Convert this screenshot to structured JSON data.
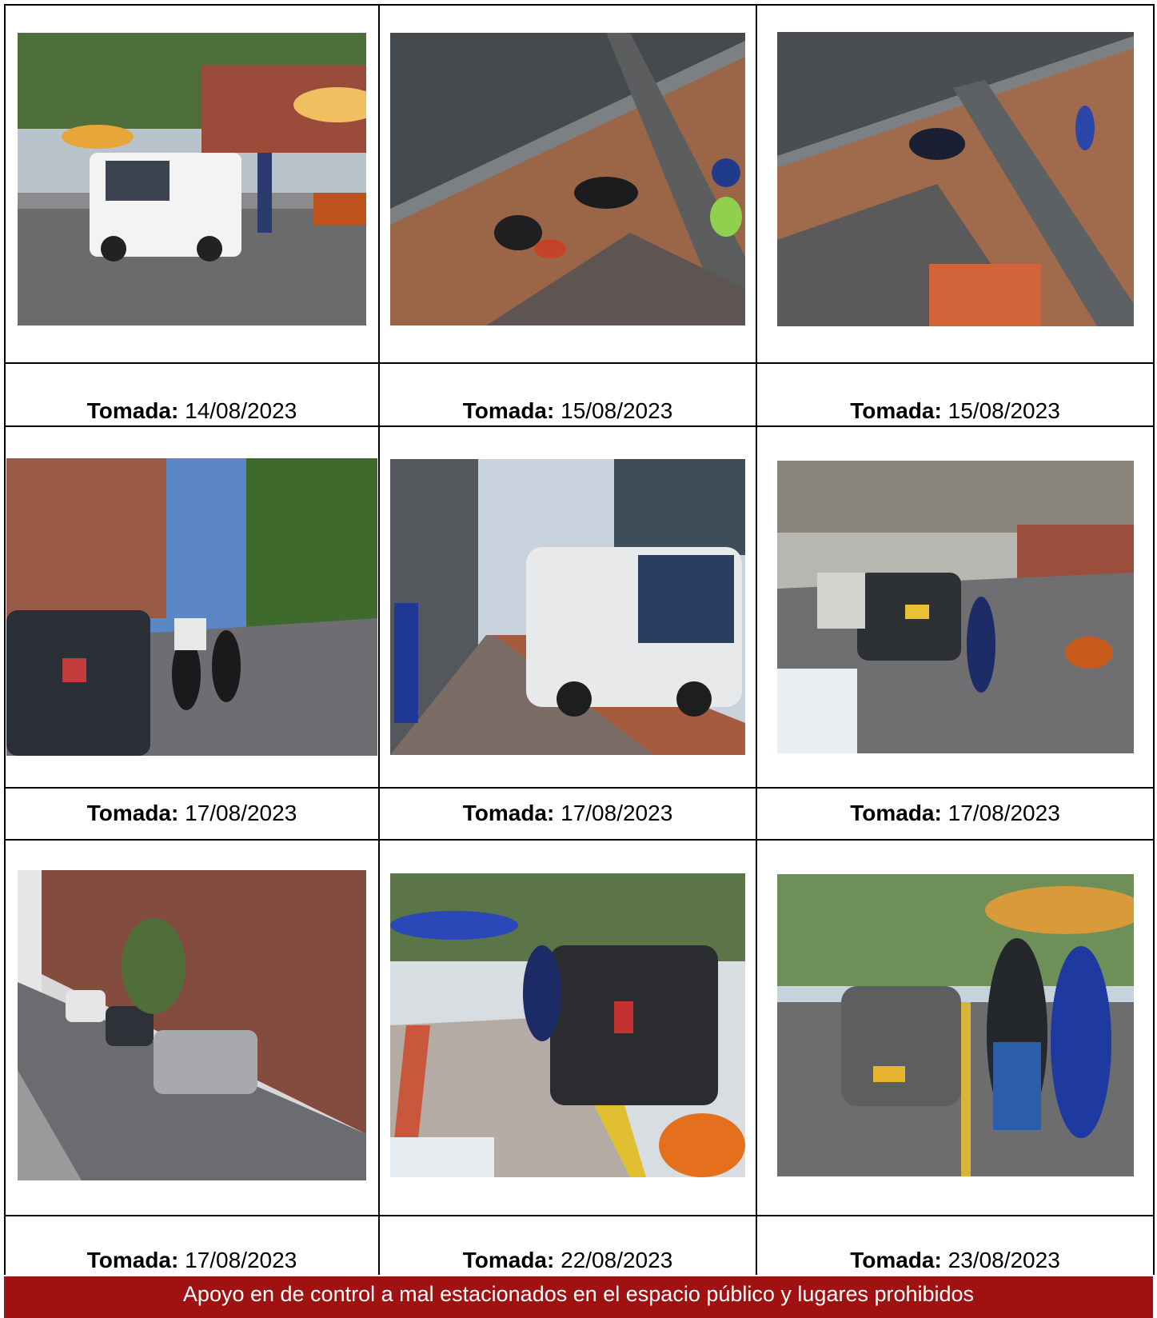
{
  "photos": [
    {
      "caption_label": "Tomada:",
      "date": "14/08/2023",
      "alt": "Camioneta blanca estacionada junto a agente en vía con sombrilla amarilla"
    },
    {
      "caption_label": "Tomada:",
      "date": "15/08/2023",
      "alt": "Vista aérea de motocicletas sobre andén de ladrillo"
    },
    {
      "caption_label": "Tomada:",
      "date": "15/08/2023",
      "alt": "Vista aérea de motocicleta y persona en andén"
    },
    {
      "caption_label": "Tomada:",
      "date": "17/08/2023",
      "alt": "Agentes en motocicleta junto a camioneta negra en calle arborizada"
    },
    {
      "caption_label": "Tomada:",
      "date": "17/08/2023",
      "alt": "Bus blanco estacionado junto a andén con agentes"
    },
    {
      "caption_label": "Tomada:",
      "date": "17/08/2023",
      "alt": "Vehículo negro y agente en vía junto a muro de ladrillo"
    },
    {
      "caption_label": "Tomada:",
      "date": "17/08/2023",
      "alt": "Vehículos estacionados junto a muro de ladrillo"
    },
    {
      "caption_label": "Tomada:",
      "date": "22/08/2023",
      "alt": "Camioneta negra estacionada sobre andén con agentes"
    },
    {
      "caption_label": "Tomada:",
      "date": "23/08/2023",
      "alt": "Automóvil gris y agentes junto a sombrilla"
    }
  ],
  "footer": {
    "text": "Apoyo en de control a mal estacionados en el espacio público y lugares prohibidos"
  },
  "colors": {
    "footer_bg": "#a01112",
    "footer_text": "#ffffff",
    "border": "#000000"
  }
}
